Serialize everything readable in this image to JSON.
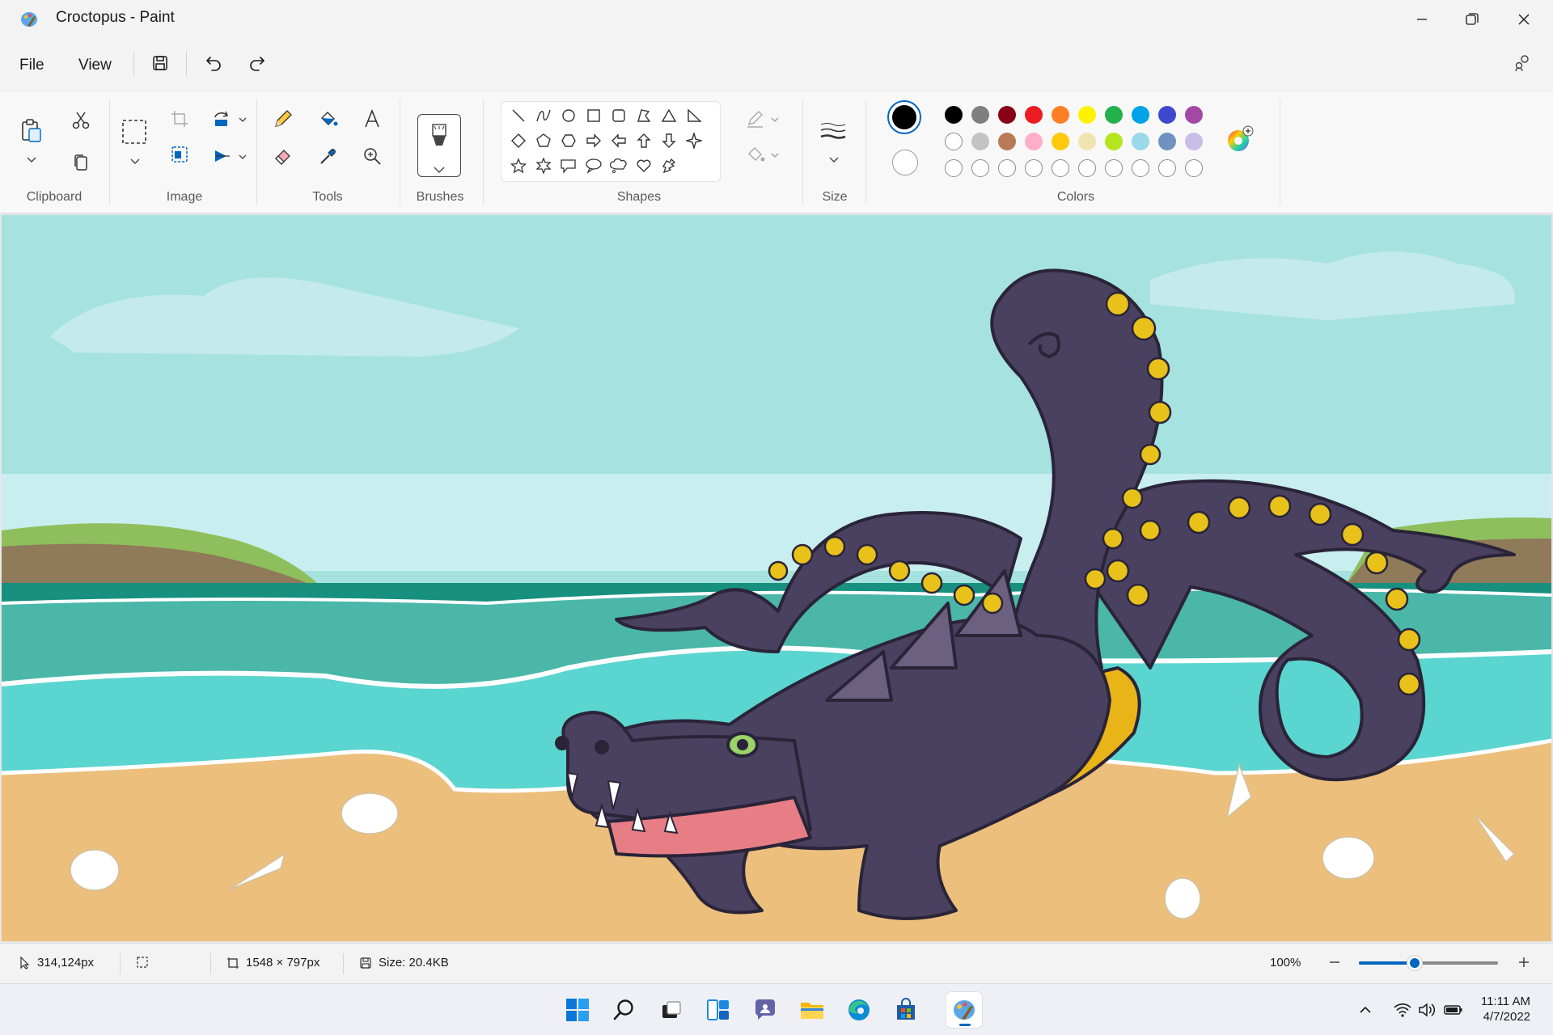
{
  "window": {
    "title": "Croctopus - Paint"
  },
  "menu": {
    "file": "File",
    "view": "View"
  },
  "ribbon": {
    "groups": {
      "clipboard": "Clipboard",
      "image": "Image",
      "tools": "Tools",
      "brushes": "Brushes",
      "shapes": "Shapes",
      "size": "Size",
      "colors": "Colors"
    },
    "colors": {
      "primary": "#000000",
      "secondary": "#ffffff",
      "palette_row1": [
        "#000000",
        "#7f7f7f",
        "#880015",
        "#ed1c24",
        "#ff7f27",
        "#fff200",
        "#22b14c",
        "#00a2e8",
        "#3f48cc",
        "#a349a4"
      ],
      "palette_row2": [
        "#ffffff",
        "#c3c3c3",
        "#b97a57",
        "#ffaec9",
        "#ffc90e",
        "#efe4b0",
        "#b5e61d",
        "#99d9ea",
        "#7092be",
        "#c8bfe7"
      ]
    }
  },
  "status": {
    "cursor_position": "314,124px",
    "canvas_dimensions": "1548 × 797px",
    "file_size": "Size: 20.4KB",
    "zoom": "100%",
    "zoom_level": 0.4
  },
  "taskbar": {
    "time": "11:11 AM",
    "date": "4/7/2022"
  }
}
